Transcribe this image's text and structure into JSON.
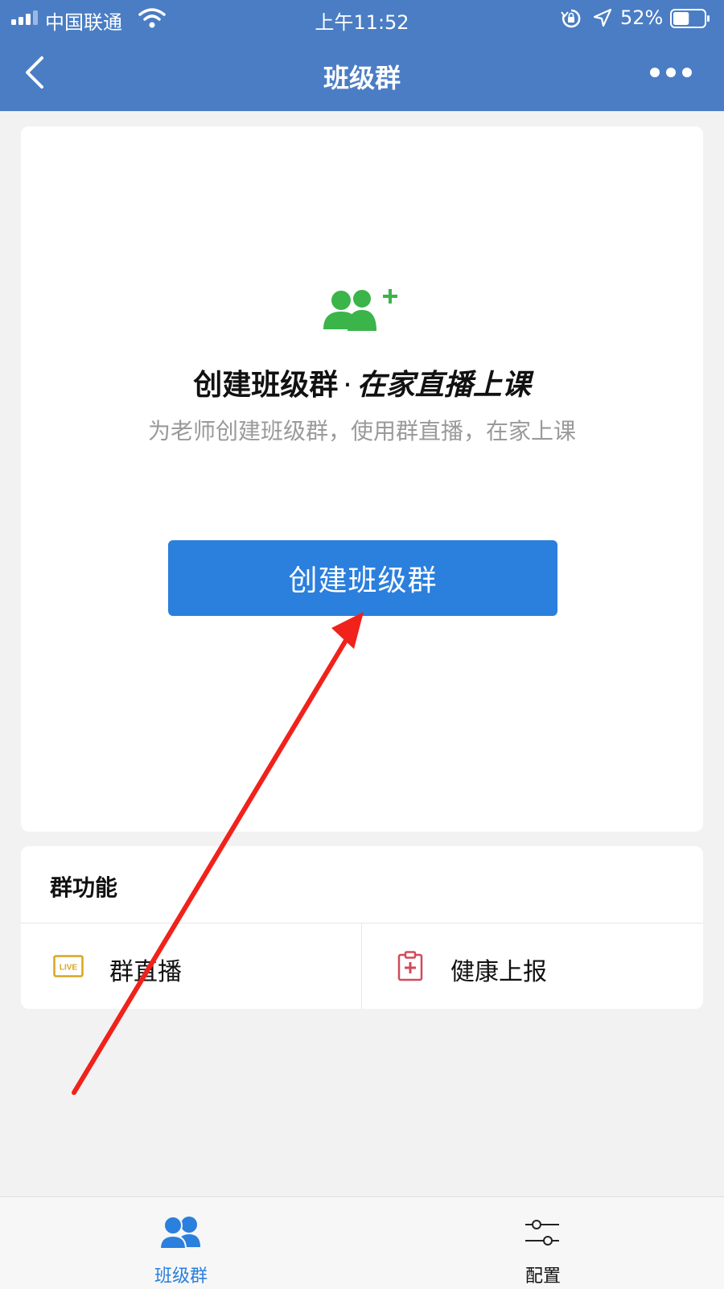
{
  "status_bar": {
    "carrier": "中国联通",
    "time": "上午11:52",
    "battery_percent": "52%",
    "battery_level": 0.52,
    "icons": [
      "signal-icon",
      "wifi-icon",
      "rotation-lock-icon",
      "location-icon",
      "battery-icon"
    ]
  },
  "nav": {
    "title": "班级群",
    "icons": [
      "back-chevron-icon",
      "more-dots-icon"
    ]
  },
  "hero": {
    "icon": "add-group-icon",
    "headline_main": "创建班级群",
    "headline_sep": "·",
    "headline_emphasis": "在家直播上课",
    "subline": "为老师创建班级群，使用群直播，在家上课",
    "button_label": "创建班级群"
  },
  "features": {
    "title": "群功能",
    "items": [
      {
        "label": "群直播",
        "icon": "live-icon"
      },
      {
        "label": "健康上报",
        "icon": "health-report-icon"
      }
    ]
  },
  "tabbar": {
    "items": [
      {
        "label": "班级群",
        "icon": "group-tab-icon",
        "active": true
      },
      {
        "label": "配置",
        "icon": "config-tab-icon",
        "active": false
      }
    ]
  },
  "colors": {
    "header": "#4a7dc4",
    "primary": "#2b7fdd",
    "icon_green": "#3bb44a",
    "live_gold": "#d9a520",
    "health_red": "#d04b5a",
    "annotation_red": "#f0221b"
  }
}
